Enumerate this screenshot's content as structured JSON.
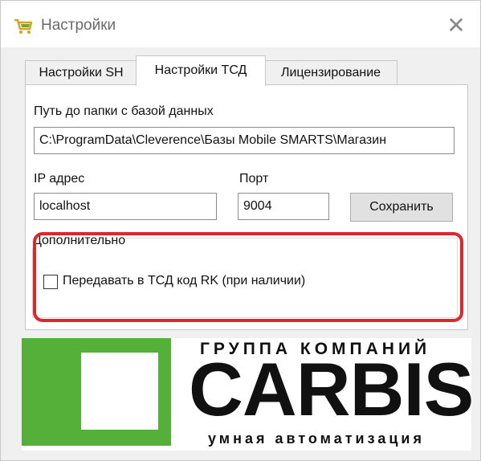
{
  "window": {
    "title": "Настройки",
    "close_icon": "close-icon"
  },
  "tabs": [
    {
      "label": "Настройки SH",
      "active": false
    },
    {
      "label": "Настройки ТСД",
      "active": true
    },
    {
      "label": "Лицензирование",
      "active": false
    }
  ],
  "form": {
    "db_path_label": "Путь до папки с базой данных",
    "db_path_value": "C:\\ProgramData\\Cleverence\\Базы Mobile SMARTS\\Магазин",
    "ip_label": "IP адрес",
    "ip_value": "localhost",
    "port_label": "Порт",
    "port_value": "9004",
    "save_label": "Сохранить"
  },
  "additional": {
    "group_title": "Дополнительно",
    "checkbox_label": "Передавать в ТСД код RK (при наличии)",
    "checkbox_checked": false,
    "highlight_color": "#e0262a"
  },
  "logo": {
    "top_text": "ГРУППА КОМПАНИЙ",
    "main_text": "CARBIS",
    "bottom_text": "умная автоматизация",
    "brand_color": "#55b03a"
  }
}
